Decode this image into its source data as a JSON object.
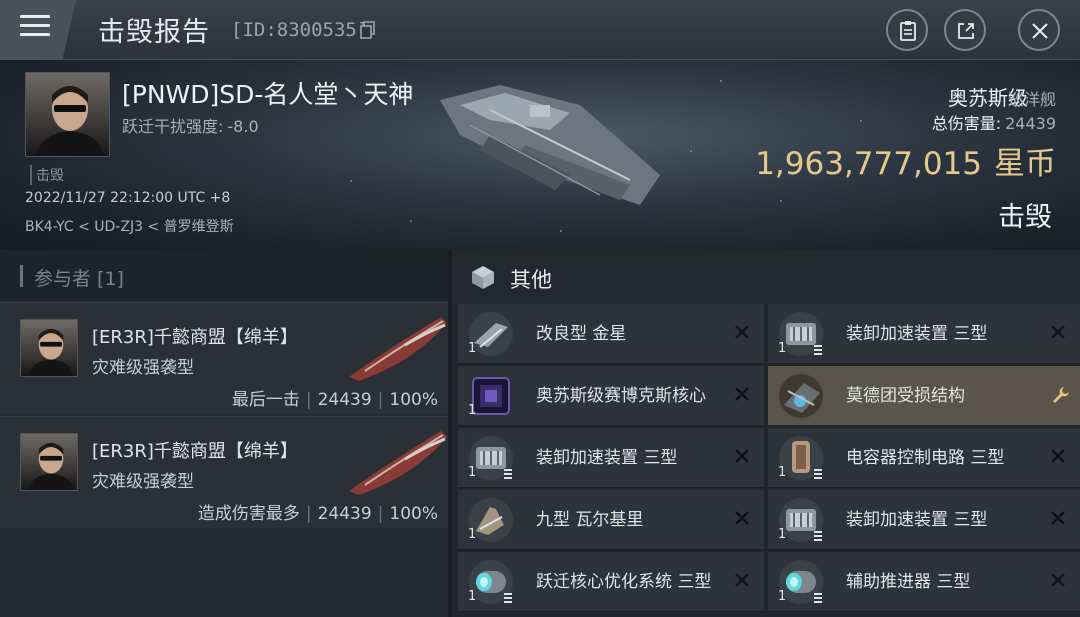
{
  "header": {
    "title": "击毁报告",
    "report_id": "[ID:8300535]"
  },
  "victim": {
    "name": "[PNWD]SD-名人堂丶天神",
    "interference_label": "跃迁干扰强度:",
    "interference_value": "-8.0",
    "kill_tag": "击毁",
    "time": "2022/11/27 22:12:00 UTC +8",
    "location": "BK4-YC < UD-ZJ3 < 普罗维登斯"
  },
  "ship": {
    "class": "奥苏斯级",
    "type": "巡洋舰",
    "damage_label": "总伤害量:",
    "damage_value": "24439",
    "value": "1,963,777,015",
    "currency": "星币",
    "status": "击毁"
  },
  "participants": {
    "heading": "参与者 [1]",
    "rows": [
      {
        "name": "[ER3R]千懿商盟【绵羊】",
        "ship": "灾难级强袭型",
        "tag": "最后一击",
        "damage": "24439",
        "pct": "100%"
      },
      {
        "name": "[ER3R]千懿商盟【绵羊】",
        "ship": "灾难级强袭型",
        "tag": "造成伤害最多",
        "damage": "24439",
        "pct": "100%"
      }
    ]
  },
  "items": {
    "heading": "其他",
    "left": [
      {
        "name": "改良型 金星",
        "qty": "1",
        "icon": "drone-icon"
      },
      {
        "name": "奥苏斯级赛博克斯核心",
        "qty": "1",
        "icon": "core-cube-icon"
      },
      {
        "name": "装卸加速装置 三型",
        "qty": "1",
        "icon": "cargo-rig-icon"
      },
      {
        "name": "九型 瓦尔基里",
        "qty": "1",
        "icon": "drone-icon"
      },
      {
        "name": "跃迁核心优化系统 三型",
        "qty": "1",
        "icon": "warp-rig-icon"
      }
    ],
    "right": [
      {
        "name": "装卸加速装置 三型",
        "qty": "1",
        "icon": "cargo-rig-icon"
      },
      {
        "name": "莫德团受损结构",
        "qty": "",
        "icon": "salvage-icon"
      },
      {
        "name": "电容器控制电路 三型",
        "qty": "1",
        "icon": "capacitor-rig-icon"
      },
      {
        "name": "装卸加速装置 三型",
        "qty": "1",
        "icon": "cargo-rig-icon"
      },
      {
        "name": "辅助推进器 三型",
        "qty": "1",
        "icon": "thruster-rig-icon"
      }
    ]
  },
  "colors": {
    "isk_gold": "#e6c98a",
    "highlight_row": "#59554a"
  }
}
